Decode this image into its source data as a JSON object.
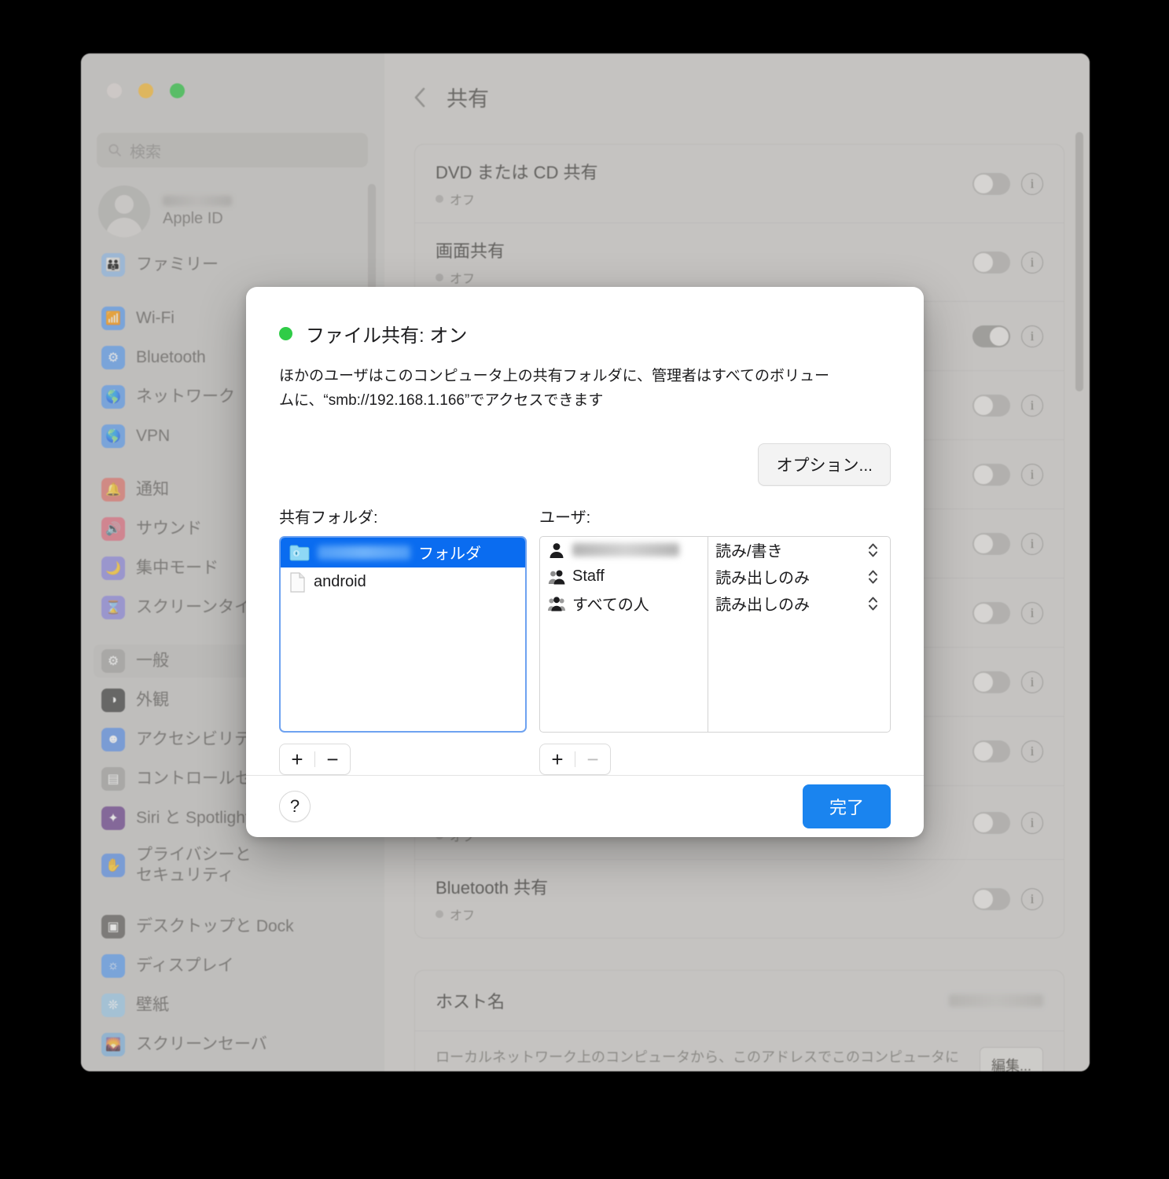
{
  "window": {
    "traffic_lights": [
      "close",
      "minimize",
      "zoom"
    ],
    "search_placeholder": "検索",
    "account": {
      "name_redacted": true,
      "subtitle": "Apple ID"
    },
    "sidebar_items": [
      {
        "label": "ファミリー",
        "icon": "family-icon",
        "color": "#8fb9e8"
      },
      {
        "label": "Wi-Fi",
        "icon": "wifi-icon",
        "color": "#5b9bf0"
      },
      {
        "label": "Bluetooth",
        "icon": "bluetooth-icon",
        "color": "#5b9bf0"
      },
      {
        "label": "ネットワーク",
        "icon": "network-icon",
        "color": "#5b9bf0"
      },
      {
        "label": "VPN",
        "icon": "vpn-icon",
        "color": "#5b9bf0"
      },
      {
        "label": "通知",
        "icon": "notifications-icon",
        "color": "#e0736c"
      },
      {
        "label": "サウンド",
        "icon": "sound-icon",
        "color": "#e06b7e"
      },
      {
        "label": "集中モード",
        "icon": "focus-icon",
        "color": "#8d86dd"
      },
      {
        "label": "スクリーンタイム",
        "icon": "screen-time-icon",
        "color": "#8d86dd"
      },
      {
        "label": "一般",
        "icon": "gear-icon",
        "color": "#a3a1a0",
        "selected": true
      },
      {
        "label": "外観",
        "icon": "appearance-icon",
        "color": "#3c3c3c"
      },
      {
        "label": "アクセシビリティ",
        "icon": "accessibility-icon",
        "color": "#5b8fe8"
      },
      {
        "label": "コントロールセンター",
        "icon": "control-center-icon",
        "color": "#a3a1a0"
      },
      {
        "label": "Siri と Spotlight",
        "icon": "siri-icon",
        "color": "#6a3f8c"
      },
      {
        "label": "プライバシーと\nセキュリティ",
        "icon": "privacy-hand-icon",
        "color": "#5b8fe8"
      },
      {
        "label": "デスクトップと Dock",
        "icon": "desktop-dock-icon",
        "color": "#5e5c5a"
      },
      {
        "label": "ディスプレイ",
        "icon": "display-icon",
        "color": "#5b9bf0"
      },
      {
        "label": "壁紙",
        "icon": "wallpaper-icon",
        "color": "#9cc9e8"
      },
      {
        "label": "スクリーンセーバ",
        "icon": "screensaver-icon",
        "color": "#7fb3e0"
      }
    ],
    "content": {
      "back_label": "戻る",
      "title": "共有",
      "rows": [
        {
          "name": "DVD または CD 共有",
          "state": "オフ",
          "toggle_on": false
        },
        {
          "name": "画面共有",
          "state": "オフ",
          "toggle_on": false
        },
        {
          "name": "",
          "state": "",
          "toggle_on": true
        },
        {
          "name": "",
          "state": "",
          "toggle_on": false
        },
        {
          "name": "",
          "state": "",
          "toggle_on": false
        },
        {
          "name": "",
          "state": "",
          "toggle_on": false
        },
        {
          "name": "",
          "state": "",
          "toggle_on": false
        },
        {
          "name": "",
          "state": "",
          "toggle_on": false
        },
        {
          "name": "",
          "state": "",
          "toggle_on": false
        },
        {
          "name": "",
          "state": "オフ",
          "toggle_on": false
        },
        {
          "name": "Bluetooth 共有",
          "state": "オフ",
          "toggle_on": false
        }
      ],
      "hostname_label": "ホスト名",
      "hostname_value_redacted": true,
      "hostname_desc": "ローカルネットワーク上のコンピュータから、このアドレスでこのコンピュータにアクセスできます。",
      "edit_label": "編集..."
    }
  },
  "sheet": {
    "status_title": "ファイル共有: オン",
    "status_color": "#2fcc47",
    "description": "ほかのユーザはこのコンピュータ上の共有フォルダに、管理者はすべてのボリュームに、“smb://192.168.1.166”でアクセスできます",
    "smb_address": "smb://192.168.1.166",
    "options_label": "オプション...",
    "folders": {
      "label": "共有フォルダ:",
      "items": [
        {
          "name_redacted": true,
          "suffix": "フォルダ",
          "icon": "public-folder-icon",
          "selected": true
        },
        {
          "name": "android",
          "icon": "document-icon",
          "selected": false
        }
      ],
      "add_label": "+",
      "remove_label": "−",
      "remove_disabled": false
    },
    "users": {
      "label": "ユーザ:",
      "items": [
        {
          "name_redacted": true,
          "icon": "person-icon",
          "permission": "読み/書き"
        },
        {
          "name": "Staff",
          "icon": "group-two-icon",
          "permission": "読み出しのみ"
        },
        {
          "name": "すべての人",
          "icon": "group-three-icon",
          "permission": "読み出しのみ"
        }
      ],
      "add_label": "+",
      "remove_label": "−",
      "remove_disabled": true
    },
    "help_label": "?",
    "done_label": "完了",
    "done_color": "#1a84ef"
  }
}
